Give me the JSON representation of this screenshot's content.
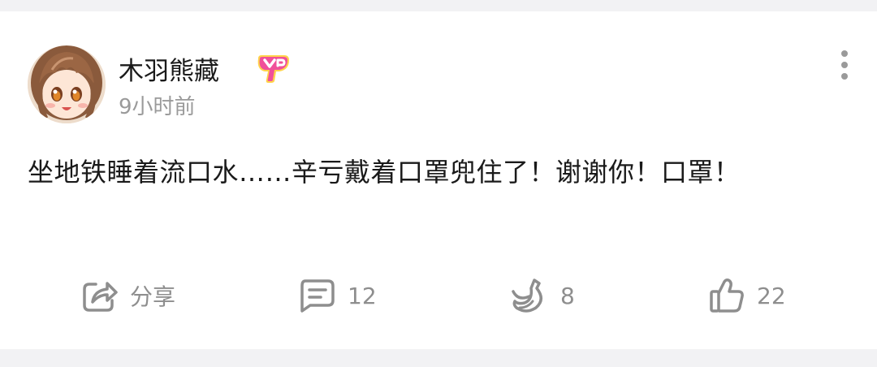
{
  "post": {
    "author": "木羽熊藏",
    "time": "9小时前",
    "text": "坐地铁睡着流口水……辛亏戴着口罩兜住了！谢谢你！口罩！"
  },
  "icons": {
    "avatar": "anime-girl-avatar",
    "vip_badge": "vip-badge-icon",
    "more": "more-vertical-icon",
    "share": "share-icon",
    "comment": "comment-icon",
    "banana": "banana-icon",
    "like": "thumbs-up-icon"
  },
  "actions": {
    "share_label": "分享",
    "comment_count": "12",
    "banana_count": "8",
    "like_count": "22"
  },
  "colors": {
    "background": "#f2f2f4",
    "card": "#ffffff",
    "text_primary": "#1a1a1a",
    "text_secondary": "#9a9a9a",
    "vip_pink": "#f0509a",
    "vip_yellow": "#ffd34a"
  }
}
